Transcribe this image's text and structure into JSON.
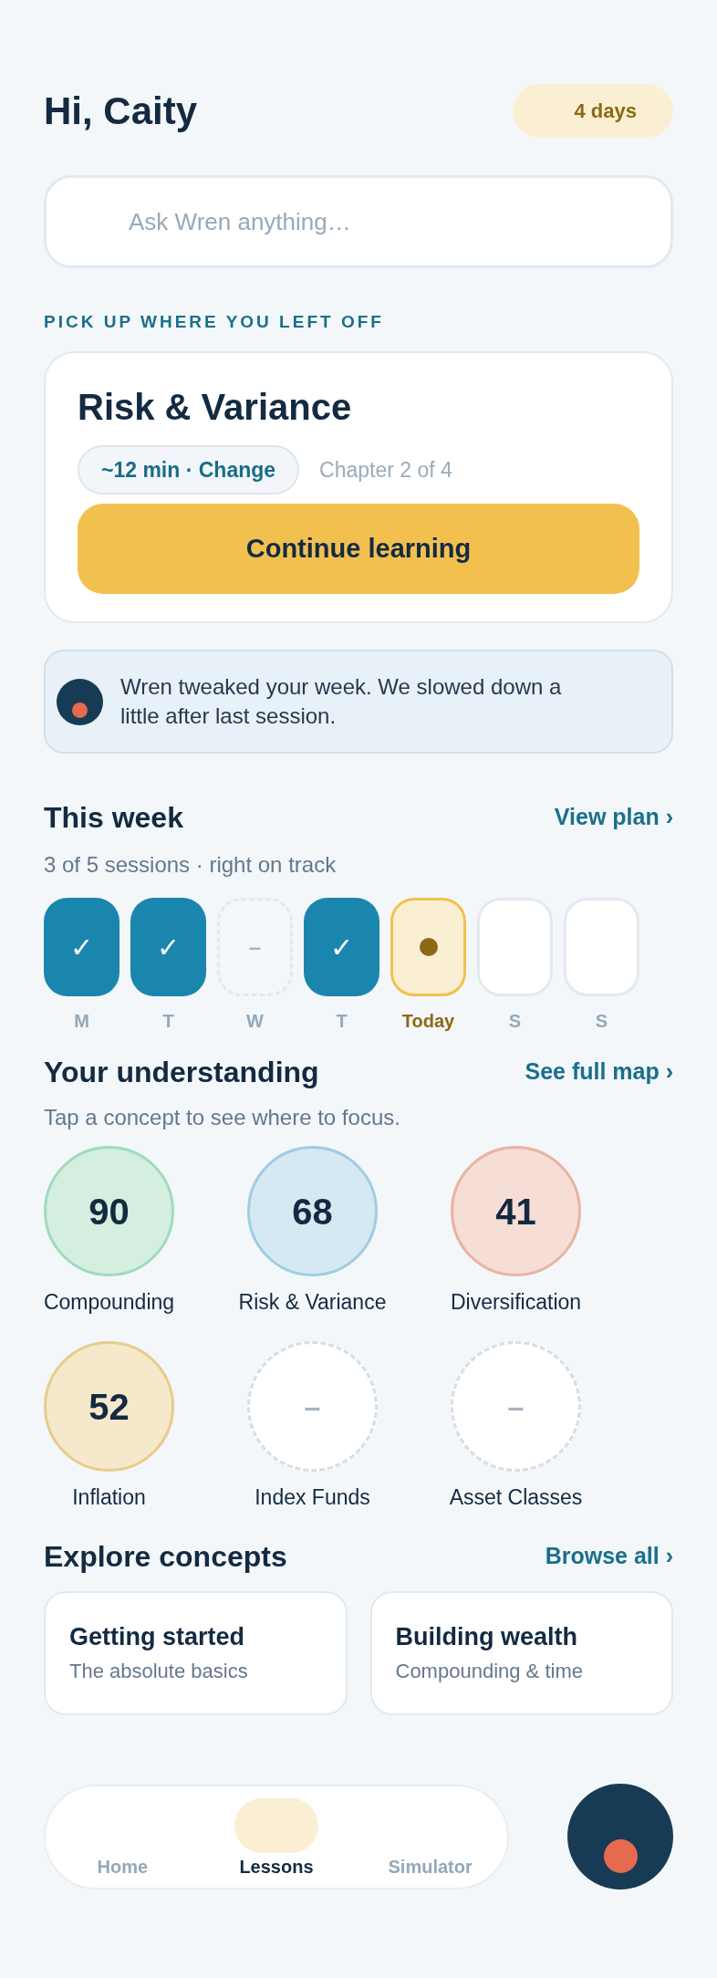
{
  "header": {
    "greeting": "Hi, Caity",
    "streak": "4 days"
  },
  "search": {
    "placeholder": "Ask Wren anything…"
  },
  "resume": {
    "eyebrow": "PICK UP WHERE YOU LEFT OFF",
    "title": "Risk & Variance",
    "duration": "~12 min · Change",
    "chapter": "Chapter 2 of 4",
    "button": "Continue learning"
  },
  "notice": {
    "text": "Wren tweaked your week. We slowed down a little after last session."
  },
  "week": {
    "title": "This week",
    "link": "View plan ›",
    "summary": "3 of 5 sessions · right on track",
    "days": [
      {
        "label": "M",
        "kind": "done",
        "mark": "✓"
      },
      {
        "label": "T",
        "kind": "done",
        "mark": "✓"
      },
      {
        "label": "W",
        "kind": "missed",
        "mark": "–"
      },
      {
        "label": "T",
        "kind": "done",
        "mark": "✓"
      },
      {
        "label": "Today",
        "kind": "today"
      },
      {
        "label": "S",
        "kind": "upcoming"
      },
      {
        "label": "S",
        "kind": "upcoming"
      }
    ]
  },
  "understanding": {
    "title": "Your understanding",
    "link": "See full map ›",
    "hint": "Tap a concept to see where to focus.",
    "concepts": [
      {
        "name": "Compounding",
        "kind": "scored",
        "score": "90",
        "color": "#9fdcbb"
      },
      {
        "name": "Risk & Variance",
        "kind": "scored",
        "score": "68",
        "color": "#9fcde2"
      },
      {
        "name": "Diversification",
        "kind": "scored",
        "score": "41",
        "color": "#eab3a2"
      },
      {
        "name": "Inflation",
        "kind": "scored",
        "score": "52",
        "color": "#e8cc8c"
      },
      {
        "name": "Index Funds",
        "kind": "unscored",
        "score": "–"
      },
      {
        "name": "Asset Classes",
        "kind": "unscored",
        "score": "–"
      }
    ]
  },
  "explore": {
    "title": "Explore concepts",
    "link": "Browse all ›",
    "cards": [
      {
        "title": "Getting started",
        "subtitle": "The absolute basics"
      },
      {
        "title": "Building wealth",
        "subtitle": "Compounding & time"
      }
    ]
  },
  "nav": {
    "tabs": [
      {
        "label": "Home",
        "selected": false
      },
      {
        "label": "Lessons",
        "selected": true
      },
      {
        "label": "Simulator",
        "selected": false
      }
    ]
  }
}
